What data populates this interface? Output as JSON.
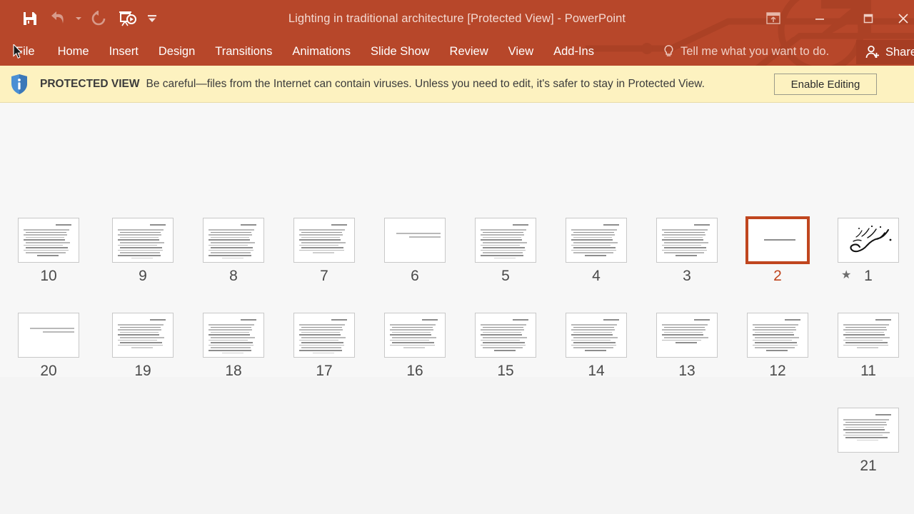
{
  "window": {
    "title": "Lighting in traditional architecture [Protected View] - PowerPoint",
    "accent_color": "#b7472a",
    "selected_color": "#c0461f"
  },
  "quick_access": {
    "items": [
      {
        "name": "save-button",
        "icon": "save-icon",
        "enabled": true
      },
      {
        "name": "undo-button",
        "icon": "undo-icon",
        "enabled": false
      },
      {
        "name": "redo-button",
        "icon": "redo-icon",
        "enabled": false
      },
      {
        "name": "start-presentation-button",
        "icon": "presentation-icon",
        "enabled": true
      },
      {
        "name": "customize-quick-access-button",
        "icon": "chevron-down-icon",
        "enabled": true
      }
    ]
  },
  "window_controls": {
    "ribbon_display_options": "ribbon-display-options-icon",
    "minimize": "minimize-icon",
    "maximize": "maximize-icon",
    "close": "close-icon"
  },
  "ribbon": {
    "tabs": [
      {
        "label": "File"
      },
      {
        "label": "Home"
      },
      {
        "label": "Insert"
      },
      {
        "label": "Design"
      },
      {
        "label": "Transitions"
      },
      {
        "label": "Animations"
      },
      {
        "label": "Slide Show"
      },
      {
        "label": "Review"
      },
      {
        "label": "View"
      },
      {
        "label": "Add-Ins"
      }
    ],
    "tell_me": "Tell me what you want to do.",
    "share_label": "Share"
  },
  "protected_view": {
    "title": "PROTECTED VIEW",
    "message": "Be careful—files from the Internet can contain viruses. Unless you need to edit, it's safer to stay in Protected View.",
    "enable_button": "Enable Editing",
    "background": "#fdf2c0"
  },
  "slide_sorter": {
    "rows": [
      {
        "slides": [
          {
            "number": "10",
            "selected": false,
            "has_animation": false,
            "content": "text-dense",
            "lines": 11
          },
          {
            "number": "9",
            "selected": false,
            "has_animation": false,
            "content": "text-dense",
            "lines": 12
          },
          {
            "number": "8",
            "selected": false,
            "has_animation": false,
            "content": "text-dense",
            "lines": 12
          },
          {
            "number": "7",
            "selected": false,
            "has_animation": false,
            "content": "text-dense",
            "lines": 10
          },
          {
            "number": "6",
            "selected": false,
            "has_animation": false,
            "content": "text-sparse",
            "lines": 2
          },
          {
            "number": "5",
            "selected": false,
            "has_animation": false,
            "content": "text-dense",
            "lines": 12
          },
          {
            "number": "4",
            "selected": false,
            "has_animation": false,
            "content": "text-dense",
            "lines": 11
          },
          {
            "number": "3",
            "selected": false,
            "has_animation": false,
            "content": "text-dense",
            "lines": 11
          },
          {
            "number": "2",
            "selected": true,
            "has_animation": false,
            "content": "text-title",
            "lines": 1
          },
          {
            "number": "1",
            "selected": false,
            "has_animation": true,
            "content": "calligraphy",
            "lines": 0
          }
        ]
      },
      {
        "slides": [
          {
            "number": "20",
            "selected": false,
            "has_animation": false,
            "content": "text-sparse",
            "lines": 2
          },
          {
            "number": "19",
            "selected": false,
            "has_animation": false,
            "content": "text-dense",
            "lines": 10
          },
          {
            "number": "18",
            "selected": false,
            "has_animation": false,
            "content": "text-dense",
            "lines": 12
          },
          {
            "number": "17",
            "selected": false,
            "has_animation": false,
            "content": "text-dense",
            "lines": 12
          },
          {
            "number": "16",
            "selected": false,
            "has_animation": false,
            "content": "text-dense",
            "lines": 10
          },
          {
            "number": "15",
            "selected": false,
            "has_animation": false,
            "content": "text-dense",
            "lines": 11
          },
          {
            "number": "14",
            "selected": false,
            "has_animation": false,
            "content": "text-dense",
            "lines": 11
          },
          {
            "number": "13",
            "selected": false,
            "has_animation": false,
            "content": "text-dense",
            "lines": 8
          },
          {
            "number": "12",
            "selected": false,
            "has_animation": false,
            "content": "text-dense",
            "lines": 11
          },
          {
            "number": "11",
            "selected": false,
            "has_animation": false,
            "content": "text-dense",
            "lines": 10
          }
        ]
      },
      {
        "slides": [
          {
            "number": "21",
            "selected": false,
            "has_animation": false,
            "content": "text-dense",
            "lines": 9
          }
        ]
      }
    ]
  }
}
